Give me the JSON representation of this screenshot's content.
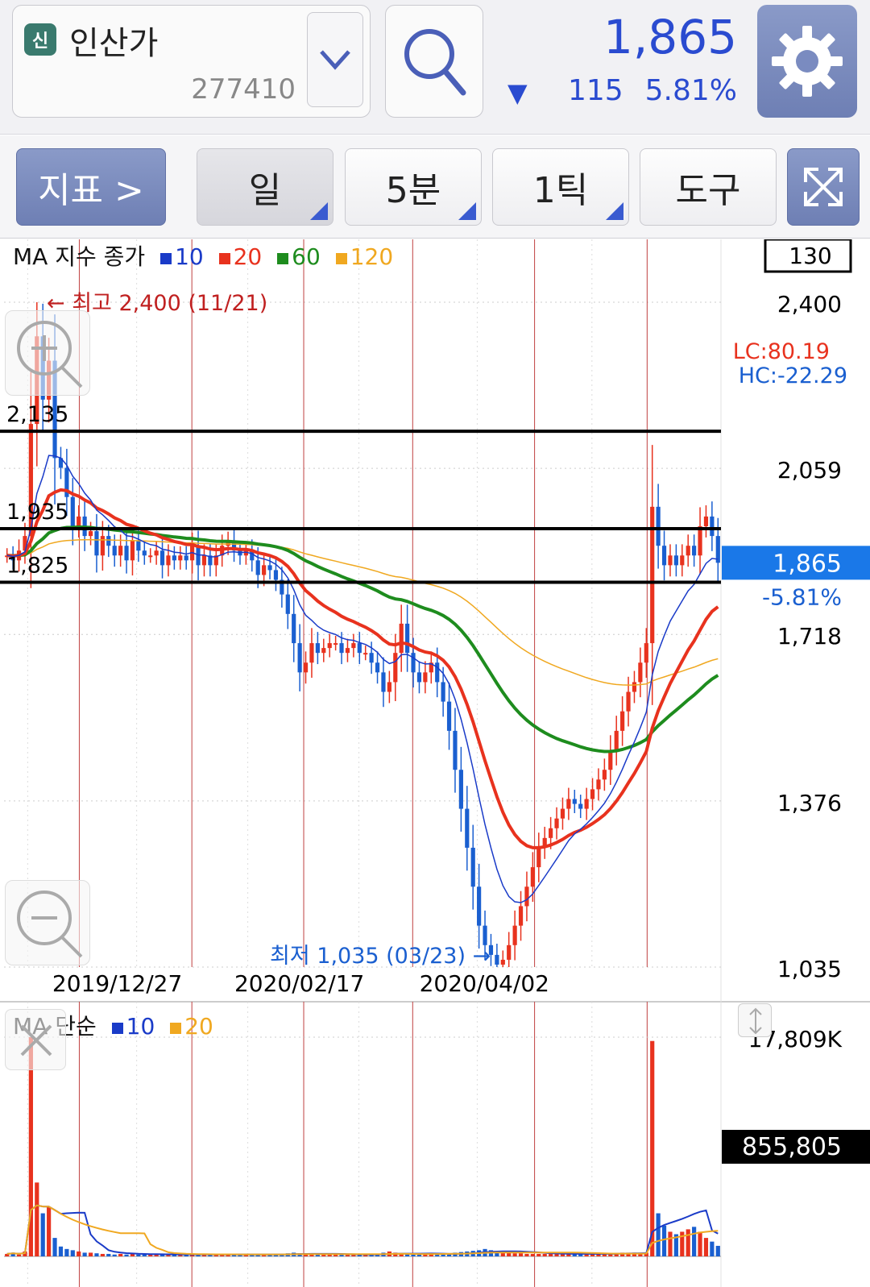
{
  "header": {
    "badge": "신",
    "stock_name": "인산가",
    "stock_code": "277410",
    "price": "1,865",
    "change_arrow": "▼",
    "change": "115",
    "change_pct": "5.81%"
  },
  "toolbar": {
    "indicator_label": "지표 >",
    "day_label": "일",
    "minute_label": "5분",
    "tick_label": "1틱",
    "tools_label": "도구"
  },
  "chart_data": [
    {
      "type": "candlestick",
      "legend": {
        "prefix": "MA 지수 종가",
        "periods": [
          "10",
          "20",
          "60",
          "120"
        ],
        "colors": [
          "#1a3bc8",
          "#e8321e",
          "#1e8c1e",
          "#f0a820"
        ]
      },
      "period_box": "130",
      "y_ticks": [
        "2,400",
        "2,059",
        "1,718",
        "1,376",
        "1,035"
      ],
      "y_range": [
        1035,
        2400
      ],
      "x_ticks": [
        "2019/12/27",
        "2020/02/17",
        "2020/04/02"
      ],
      "current_price": "1,865",
      "current_change": "-5.81%",
      "lc": "LC:80.19",
      "hc": "HC:-22.29",
      "high_annotation": "← 최고 2,400 (11/21)",
      "low_annotation": "최저 1,035 (03/23) →",
      "hlines": [
        {
          "label": "2,135",
          "value": 2135
        },
        {
          "label": "1,935",
          "value": 1935
        },
        {
          "label": "1,825",
          "value": 1825
        }
      ],
      "close_series": [
        1880,
        1870,
        1890,
        1920,
        2150,
        2330,
        2200,
        2280,
        2080,
        2060,
        2000,
        1940,
        1960,
        1920,
        1930,
        1880,
        1920,
        1900,
        1880,
        1900,
        1870,
        1910,
        1890,
        1880,
        1880,
        1890,
        1860,
        1880,
        1870,
        1880,
        1870,
        1900,
        1860,
        1880,
        1860,
        1880,
        1900,
        1910,
        1890,
        1880,
        1890,
        1870,
        1840,
        1860,
        1850,
        1830,
        1800,
        1760,
        1700,
        1640,
        1660,
        1700,
        1680,
        1690,
        1700,
        1700,
        1680,
        1690,
        1700,
        1680,
        1680,
        1660,
        1640,
        1600,
        1620,
        1680,
        1740,
        1680,
        1640,
        1620,
        1640,
        1660,
        1620,
        1580,
        1520,
        1440,
        1360,
        1280,
        1200,
        1120,
        1080,
        1060,
        1040,
        1050,
        1080,
        1120,
        1160,
        1200,
        1240,
        1280,
        1300,
        1320,
        1340,
        1360,
        1380,
        1370,
        1360,
        1380,
        1400,
        1420,
        1440,
        1480,
        1520,
        1560,
        1600,
        1620,
        1660,
        1700,
        1980,
        1900,
        1860,
        1880,
        1860,
        1880,
        1900,
        1880,
        1940,
        1960,
        1920,
        1865
      ]
    },
    {
      "type": "bar",
      "legend": {
        "prefix": "MA 단순",
        "periods": [
          "10",
          "20"
        ],
        "colors": [
          "#1a3bc8",
          "#f0a820"
        ]
      },
      "y_ticks": [
        "17,809K"
      ],
      "current_volume": "855,805",
      "volume_max": 17809,
      "volume_series": [
        200,
        300,
        150,
        400,
        17809,
        6000,
        3500,
        4000,
        1500,
        800,
        600,
        500,
        400,
        300,
        300,
        250,
        200,
        200,
        150,
        200,
        150,
        200,
        150,
        150,
        200,
        150,
        150,
        150,
        150,
        150,
        150,
        200,
        150,
        150,
        150,
        150,
        200,
        150,
        150,
        150,
        150,
        150,
        150,
        150,
        150,
        150,
        200,
        250,
        300,
        250,
        200,
        200,
        150,
        150,
        150,
        150,
        150,
        150,
        150,
        150,
        150,
        150,
        200,
        300,
        400,
        300,
        250,
        200,
        150,
        150,
        200,
        200,
        150,
        200,
        250,
        300,
        350,
        400,
        450,
        500,
        600,
        500,
        400,
        350,
        300,
        250,
        250,
        200,
        200,
        200,
        200,
        200,
        200,
        200,
        200,
        200,
        200,
        200,
        200,
        200,
        200,
        250,
        250,
        300,
        300,
        300,
        300,
        300,
        17500,
        3500,
        2500,
        2000,
        1800,
        2000,
        2200,
        2400,
        2000,
        1500,
        1200,
        856
      ]
    }
  ]
}
